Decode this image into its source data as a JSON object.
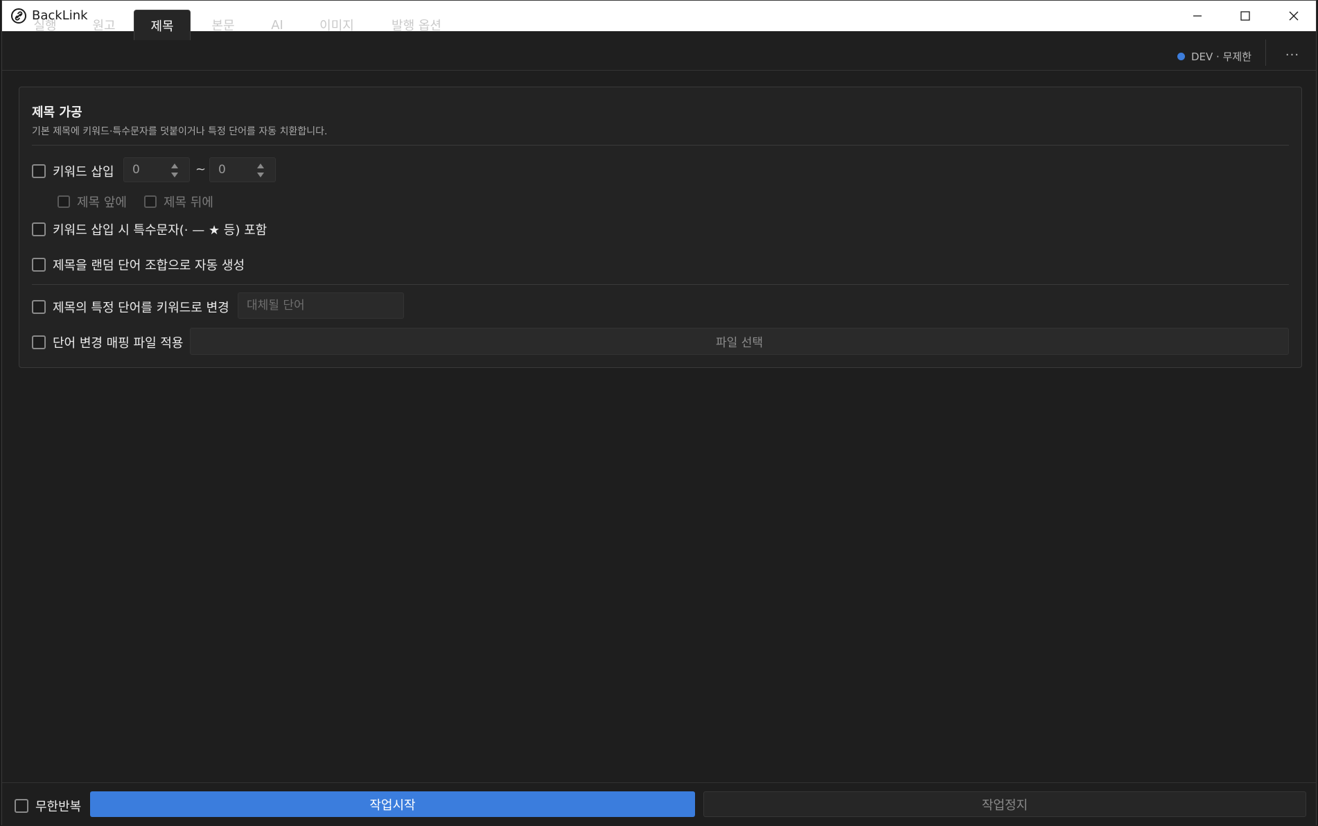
{
  "window": {
    "title": "BackLink"
  },
  "tabs": [
    {
      "label": "실행"
    },
    {
      "label": "원고"
    },
    {
      "label": "제목",
      "active": true
    },
    {
      "label": "본문"
    },
    {
      "label": "AI"
    },
    {
      "label": "이미지"
    },
    {
      "label": "발행 옵션"
    }
  ],
  "status": {
    "badge": "DEV · 무제한",
    "badge_color": "#3d7ddb",
    "more_label": "···"
  },
  "panel": {
    "title": "제목 가공",
    "description": "기본 제목에 키워드·특수문자를 덧붙이거나 특정 단어를 자동 치환합니다.",
    "keyword_insert": {
      "label": "키워드 삽입",
      "checked": false,
      "min_value": "0",
      "max_value": "0",
      "range_separator": "~",
      "before_label": "제목 앞에",
      "after_label": "제목 뒤에"
    },
    "special_chars": {
      "label": "키워드 삽입 시 특수문자(· — ★ 등) 포함",
      "checked": false
    },
    "random_title": {
      "label": "제목을 랜덤 단어 조합으로 자동 생성",
      "checked": false
    },
    "replace_word": {
      "label": "제목의 특정 단어를 키워드로 변경",
      "checked": false,
      "value": "",
      "placeholder": "대체될 단어"
    },
    "mapping_file": {
      "label": "단어 변경 매핑 파일 적용",
      "checked": false,
      "button_label": "파일 선택"
    }
  },
  "footer": {
    "repeat_label": "무한반복",
    "repeat_checked": false,
    "start_label": "작업시작",
    "stop_label": "작업정지",
    "start_color": "#3b7ddd"
  }
}
